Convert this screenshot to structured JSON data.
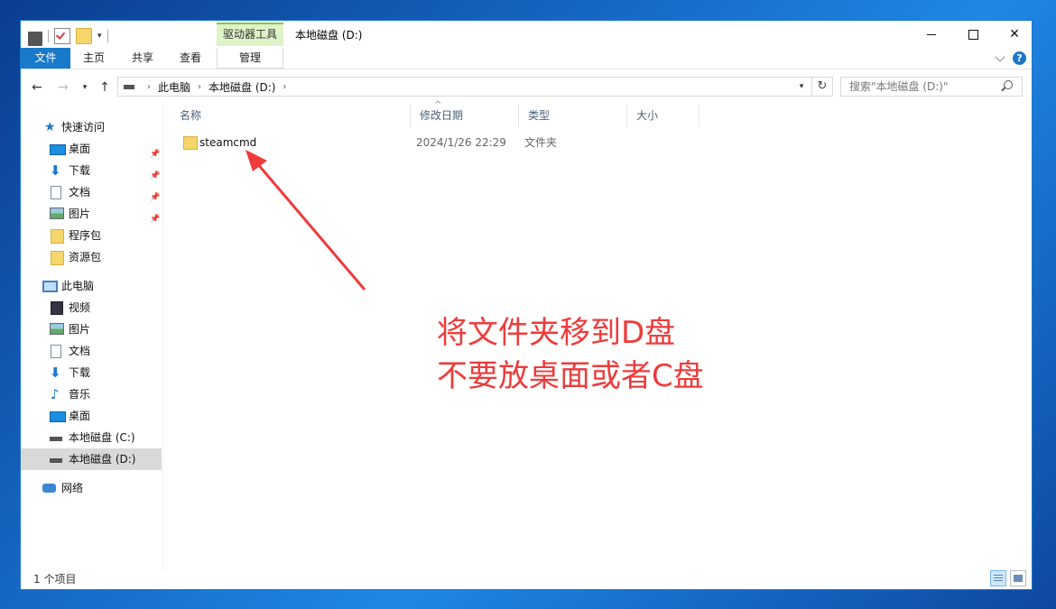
{
  "window": {
    "title": "本地磁盘 (D:)",
    "context_tab": "驱动器工具"
  },
  "ribbon": {
    "tabs": [
      "文件",
      "主页",
      "共享",
      "查看",
      "管理"
    ]
  },
  "address": {
    "crumbs": [
      "此电脑",
      "本地磁盘 (D:)"
    ],
    "search_placeholder": "搜索\"本地磁盘 (D:)\""
  },
  "nav": {
    "quick_access": "快速访问",
    "quick_items": [
      "桌面",
      "下载",
      "文档",
      "图片",
      "程序包",
      "资源包"
    ],
    "this_pc": "此电脑",
    "pc_items": [
      "视频",
      "图片",
      "文档",
      "下载",
      "音乐",
      "桌面",
      "本地磁盘 (C:)",
      "本地磁盘 (D:)"
    ],
    "network": "网络"
  },
  "columns": [
    "名称",
    "修改日期",
    "类型",
    "大小"
  ],
  "files": [
    {
      "name": "steamcmd",
      "modified": "2024/1/26 22:29",
      "type": "文件夹",
      "size": ""
    }
  ],
  "status": {
    "count": "1 个项目"
  },
  "annotation": {
    "line1": "将文件夹移到D盘",
    "line2": "不要放桌面或者C盘",
    "color": "#ee3b3b"
  },
  "colors": {
    "accent": "#1979ca",
    "context_tab_bg": "#dff3c8"
  }
}
